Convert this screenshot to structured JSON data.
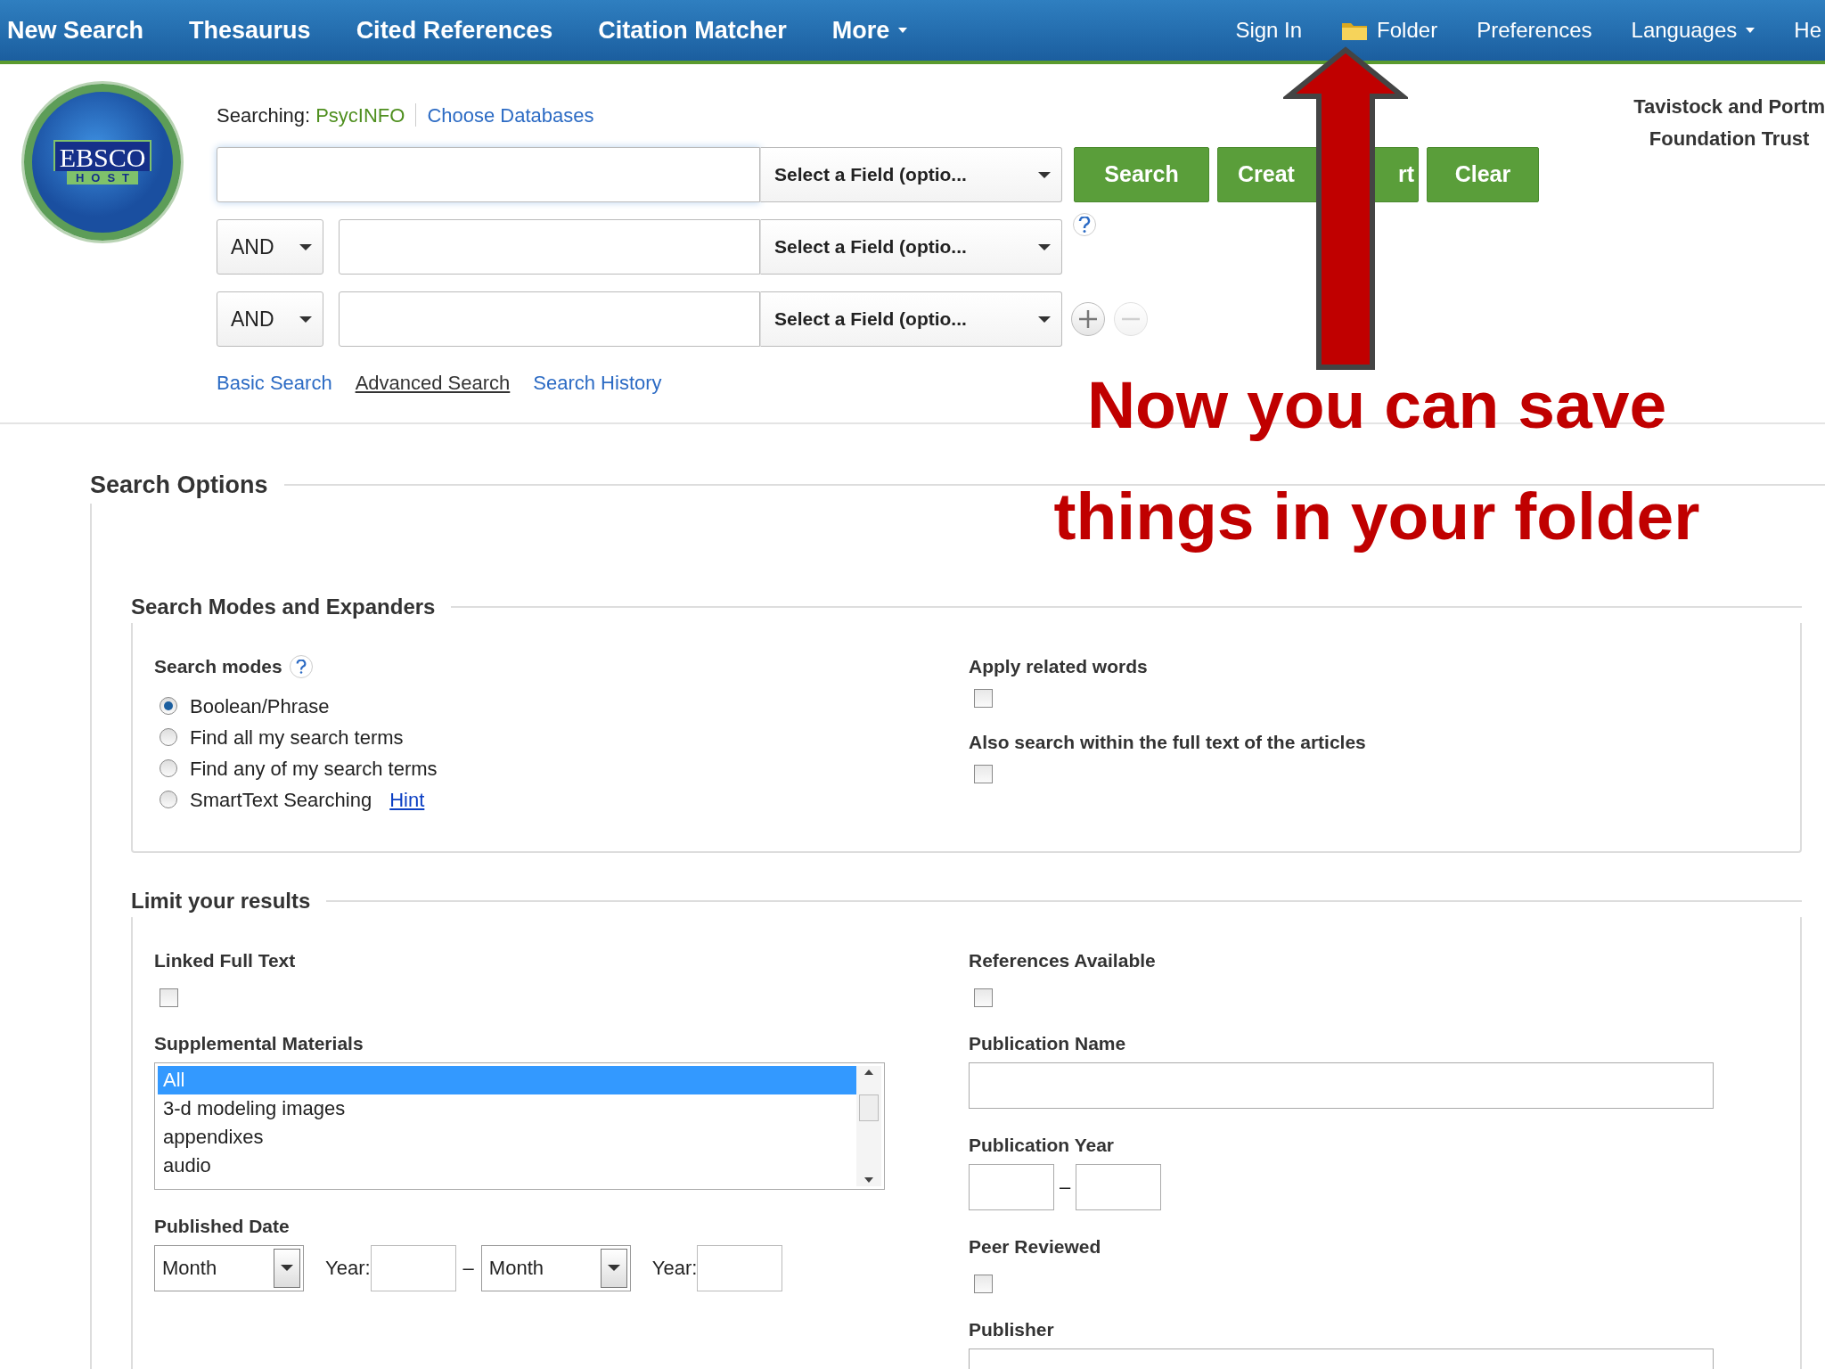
{
  "nav": {
    "left": [
      {
        "label": "New Search",
        "dropdown": false
      },
      {
        "label": "Thesaurus",
        "dropdown": false
      },
      {
        "label": "Cited References",
        "dropdown": false
      },
      {
        "label": "Citation Matcher",
        "dropdown": false
      },
      {
        "label": "More",
        "dropdown": true
      }
    ],
    "right": [
      {
        "label": "Sign In",
        "kind": "link",
        "dropdown": false
      },
      {
        "label": "Folder",
        "kind": "folder",
        "dropdown": false
      },
      {
        "label": "Preferences",
        "kind": "link",
        "dropdown": false
      },
      {
        "label": "Languages",
        "kind": "link",
        "dropdown": true
      },
      {
        "label": "He",
        "kind": "link",
        "dropdown": false
      }
    ]
  },
  "logo": {
    "line1": "EBSCO",
    "line2": "HOST"
  },
  "searching": {
    "label": "Searching:",
    "database": "PsycINFO",
    "choose_link": "Choose Databases"
  },
  "search_rows": [
    {
      "field": "Select a Field (optio..."
    },
    {
      "operator": "AND",
      "field": "Select a Field (optio..."
    },
    {
      "operator": "AND",
      "field": "Select a Field (optio..."
    }
  ],
  "buttons": [
    {
      "parts": [
        "Search"
      ]
    },
    {
      "parts": [
        "Creat",
        "rt"
      ]
    },
    {
      "parts": [
        "Clear"
      ]
    }
  ],
  "remove_row": {
    "disabled": true
  },
  "institution": [
    "Tavistock and Portm",
    "Foundation Trust"
  ],
  "search_links": [
    {
      "label": "Basic Search",
      "selected": false
    },
    {
      "label": "Advanced Search",
      "selected": true
    },
    {
      "label": "Search History",
      "selected": false
    }
  ],
  "search_options": {
    "title": "Search Options",
    "modes_section": {
      "title": "Search Modes and Expanders",
      "modes_label": "Search modes",
      "modes": [
        {
          "label": "Boolean/Phrase",
          "selected": true
        },
        {
          "label": "Find all my search terms",
          "selected": false
        },
        {
          "label": "Find any of my search terms",
          "selected": false
        },
        {
          "label": "SmartText Searching",
          "selected": false,
          "hint": "Hint"
        }
      ],
      "expanders": [
        {
          "label": "Apply related words",
          "checked": false
        },
        {
          "label": "Also search within the full text of the articles",
          "checked": false
        }
      ]
    },
    "limits": {
      "title": "Limit your results",
      "left": [
        {
          "kind": "checkbox",
          "label": "Linked Full Text",
          "checked": false
        },
        {
          "kind": "listbox",
          "label": "Supplemental Materials",
          "options": [
            {
              "label": "All",
              "selected": true
            },
            {
              "label": "3-d modeling images",
              "selected": false
            },
            {
              "label": "appendixes",
              "selected": false
            },
            {
              "label": "audio",
              "selected": false
            }
          ]
        },
        {
          "kind": "date_range",
          "label": "Published Date",
          "from_month": "Month",
          "from_year_label": "Year:",
          "separator": "–",
          "to_month": "Month",
          "to_year_label": "Year:"
        }
      ],
      "right": [
        {
          "kind": "checkbox",
          "label": "References Available",
          "checked": false
        },
        {
          "kind": "text",
          "label": "Publication Name"
        },
        {
          "kind": "year_range",
          "label": "Publication Year",
          "separator": "–"
        },
        {
          "kind": "checkbox",
          "label": "Peer Reviewed",
          "checked": false
        },
        {
          "kind": "text",
          "label": "Publisher"
        }
      ]
    }
  },
  "annotation": {
    "lines": [
      "Now you can save",
      "things in your folder"
    ]
  }
}
